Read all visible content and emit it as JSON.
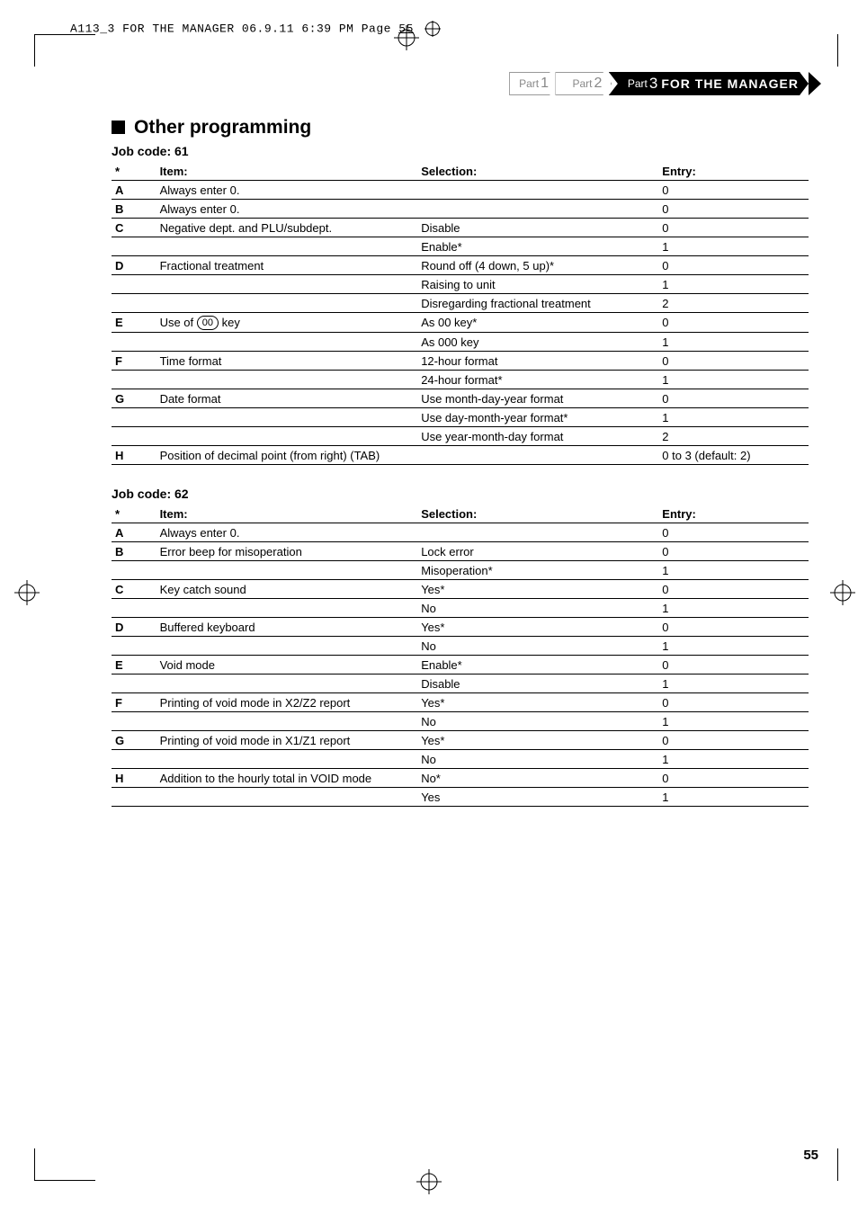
{
  "header_line": {
    "text": "A113_3 FOR THE MANAGER  06.9.11 6:39 PM  Page",
    "page": "55"
  },
  "nav": {
    "part1": {
      "prefix": "Part",
      "num": "1"
    },
    "part2": {
      "prefix": "Part",
      "num": "2"
    },
    "part3": {
      "prefix": "Part",
      "num": "3",
      "label": "FOR THE MANAGER"
    }
  },
  "section_title": "Other programming",
  "headers": {
    "item": "Item:",
    "selection": "Selection:",
    "entry": "Entry:"
  },
  "job61": {
    "label": "Job code:  61",
    "rows": [
      {
        "l": "A",
        "item": "Always enter 0.",
        "sel": "",
        "entry": "0"
      },
      {
        "l": "B",
        "item": "Always enter 0.",
        "sel": "",
        "entry": "0"
      },
      {
        "l": "C",
        "item": "Negative dept. and PLU/subdept.",
        "sel": "Disable",
        "entry": "0"
      },
      {
        "l": "",
        "item": "",
        "sel": "Enable*",
        "entry": "1"
      },
      {
        "l": "D",
        "item": "Fractional treatment",
        "sel": "Round off (4 down, 5 up)*",
        "entry": "0"
      },
      {
        "l": "",
        "item": "",
        "sel": "Raising to unit",
        "entry": "1"
      },
      {
        "l": "",
        "item": "",
        "sel": "Disregarding fractional treatment",
        "entry": "2"
      },
      {
        "l": "E",
        "item": "Use of __KEY00__ key",
        "sel": "As 00 key*",
        "entry": "0"
      },
      {
        "l": "",
        "item": "",
        "sel": "As 000 key",
        "entry": "1"
      },
      {
        "l": "F",
        "item": "Time format",
        "sel": "12-hour format",
        "entry": "0"
      },
      {
        "l": "",
        "item": "",
        "sel": "24-hour format*",
        "entry": "1"
      },
      {
        "l": "G",
        "item": "Date format",
        "sel": "Use month-day-year format",
        "entry": "0"
      },
      {
        "l": "",
        "item": "",
        "sel": "Use day-month-year format*",
        "entry": "1"
      },
      {
        "l": "",
        "item": "",
        "sel": "Use year-month-day format",
        "entry": "2"
      },
      {
        "l": "H",
        "item": "Position of decimal point (from right) (TAB)",
        "sel": "",
        "entry": "0 to 3 (default: 2)"
      }
    ]
  },
  "job62": {
    "label": "Job code:  62",
    "rows": [
      {
        "l": "A",
        "item": "Always enter 0.",
        "sel": "",
        "entry": "0"
      },
      {
        "l": "B",
        "item": "Error beep for misoperation",
        "sel": "Lock error",
        "entry": "0"
      },
      {
        "l": "",
        "item": "",
        "sel": "Misoperation*",
        "entry": "1"
      },
      {
        "l": "C",
        "item": "Key catch sound",
        "sel": "Yes*",
        "entry": "0"
      },
      {
        "l": "",
        "item": "",
        "sel": "No",
        "entry": "1"
      },
      {
        "l": "D",
        "item": "Buffered keyboard",
        "sel": "Yes*",
        "entry": "0"
      },
      {
        "l": "",
        "item": "",
        "sel": "No",
        "entry": "1"
      },
      {
        "l": "E",
        "item": "Void mode",
        "sel": "Enable*",
        "entry": "0"
      },
      {
        "l": "",
        "item": "",
        "sel": "Disable",
        "entry": "1"
      },
      {
        "l": "F",
        "item": "Printing of void mode in X2/Z2 report",
        "sel": "Yes*",
        "entry": "0"
      },
      {
        "l": "",
        "item": "",
        "sel": "No",
        "entry": "1"
      },
      {
        "l": "G",
        "item": "Printing of void mode in X1/Z1 report",
        "sel": "Yes*",
        "entry": "0"
      },
      {
        "l": "",
        "item": "",
        "sel": "No",
        "entry": "1"
      },
      {
        "l": "H",
        "item": "Addition to the hourly total in VOID mode",
        "sel": "No*",
        "entry": "0"
      },
      {
        "l": "",
        "item": "",
        "sel": "Yes",
        "entry": "1"
      }
    ]
  },
  "page_number": "55",
  "key00_glyph": "00"
}
